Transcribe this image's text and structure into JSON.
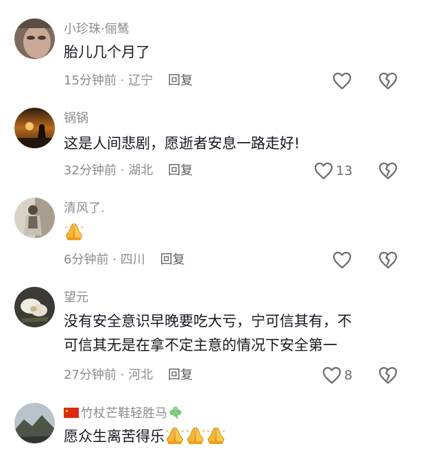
{
  "comments": [
    {
      "username": "小珍珠·俪鸶",
      "text": "胎儿几个月了",
      "time": "15分钟前",
      "location": "辽宁",
      "reply_label": "回复",
      "likes": ""
    },
    {
      "username": "锅锅",
      "text": "这是人间悲剧，愿逝者安息一路走好!",
      "time": "32分钟前",
      "location": "湖北",
      "reply_label": "回复",
      "likes": "13"
    },
    {
      "username": "清风了.",
      "text": "",
      "emoji": "pray-emoji",
      "time": "6分钟前",
      "location": "四川",
      "reply_label": "回复",
      "likes": ""
    },
    {
      "username": "望元",
      "text_line1": "没有安全意识早晚要吃大亏，宁可信其有，不",
      "text_line2": "可信其无是在拿不定主意的情况下安全第一",
      "time": "27分钟前",
      "location": "河北",
      "reply_label": "回复",
      "likes": "8"
    },
    {
      "username": "竹杖芒鞋轻胜马",
      "username_prefix_icon": "china-flag-icon",
      "username_suffix_icon": "clover-icon",
      "text": "愿众生离苦得乐",
      "emoji": "pray-emoji",
      "time": "",
      "location": ""
    }
  ],
  "separator": " · ",
  "colors": {
    "primary_text": "#161823",
    "secondary_text": "#8a8b91",
    "icon": "#6c6d72"
  }
}
